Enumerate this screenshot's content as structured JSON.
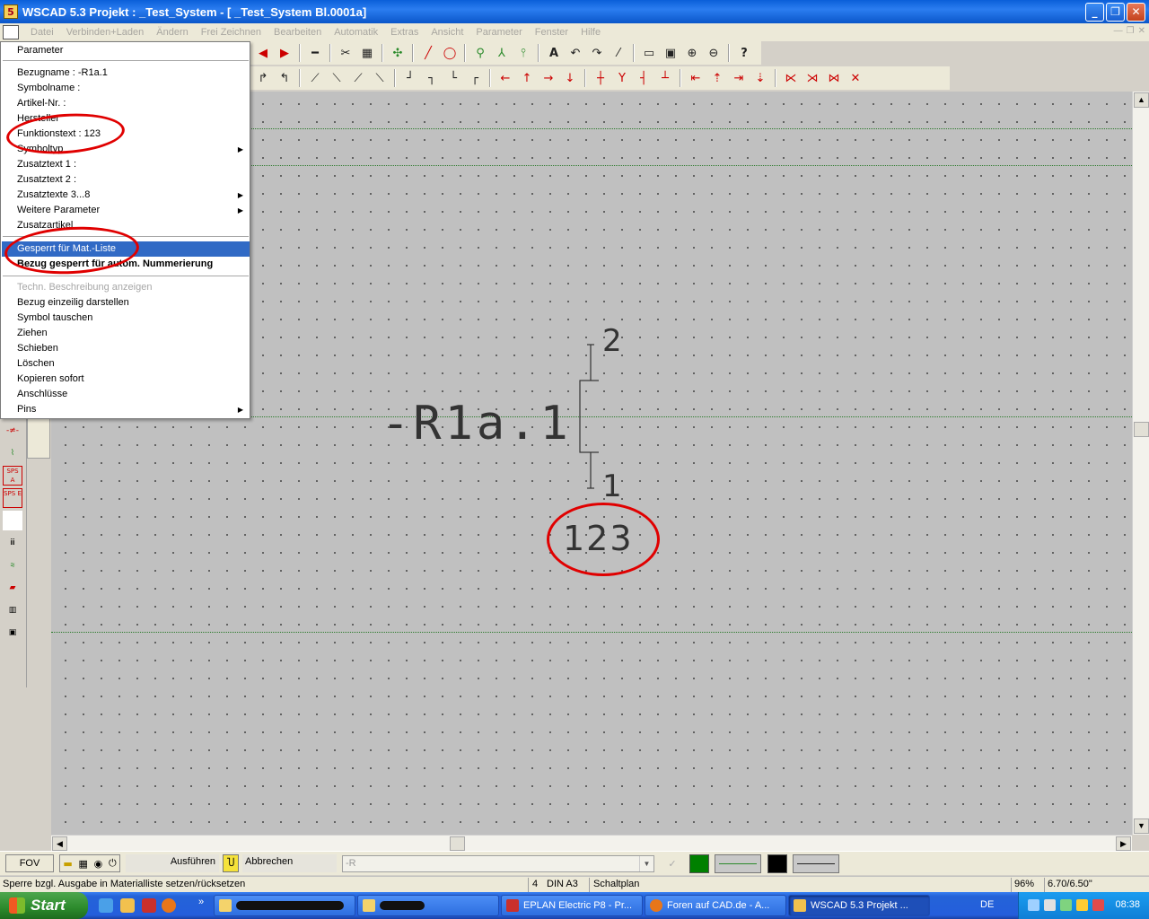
{
  "window": {
    "title": "WSCAD 5.3   Projekt :  _Test_System  - [  _Test_System   Bl.0001a]",
    "app_icon": "5"
  },
  "menubar": [
    "Datei",
    "Verbinden+Laden",
    "Ändern",
    "Frei Zeichnen",
    "Bearbeiten",
    "Automatik",
    "Extras",
    "Ansicht",
    "Parameter",
    "Fenster",
    "Hilfe"
  ],
  "context_menu": {
    "header": "Parameter",
    "items": [
      {
        "label": "Bezugname     :  -R1a.1"
      },
      {
        "label": "Symbolname    :"
      },
      {
        "label": "Artikel-Nr.       :"
      },
      {
        "label": "Hersteller"
      },
      {
        "label": "Funktionstext  :  123"
      },
      {
        "label": "Symboltyp",
        "submenu": true
      },
      {
        "label": "Zusatztext 1    :"
      },
      {
        "label": "Zusatztext 2    :"
      },
      {
        "label": "Zusatztexte 3...8",
        "submenu": true
      },
      {
        "label": "Weitere Parameter",
        "submenu": true
      },
      {
        "label": "Zusatzartikel"
      }
    ],
    "selected": "Gesperrt für Mat.-Liste",
    "bold_item": "Bezug gesperrt für autom. Nummerierung",
    "disabled_item": "Techn. Beschreibung anzeigen",
    "actions": [
      "Bezug einzeilig darstellen",
      "Symbol tauschen",
      "Ziehen",
      "Schieben",
      "Löschen",
      "Kopieren sofort",
      "Anschlüsse",
      "Pins"
    ]
  },
  "drawing": {
    "reference": "-R1a.1",
    "pin_top": "2",
    "pin_bottom": "1",
    "function_text": "123"
  },
  "cmdbar": {
    "fov": "FOV",
    "execute": "Ausführen",
    "abort": "Abbrechen",
    "input_value": "-R",
    "green": "#008000",
    "black": "#000000"
  },
  "statusbar": {
    "hint": "Sperre bzgl. Ausgabe in Materialliste setzen/rücksetzen",
    "sheet": "4",
    "format": "DIN A3",
    "type": "Schaltplan",
    "zoom": "96%",
    "coords": "6.70/6.50\""
  },
  "taskbar": {
    "start": "Start",
    "tasks": [
      "EPLAN Electric P8 - Pr...",
      "Foren auf CAD.de - A...",
      "WSCAD 5.3   Projekt ..."
    ],
    "lang": "DE",
    "clock": "08:38"
  }
}
